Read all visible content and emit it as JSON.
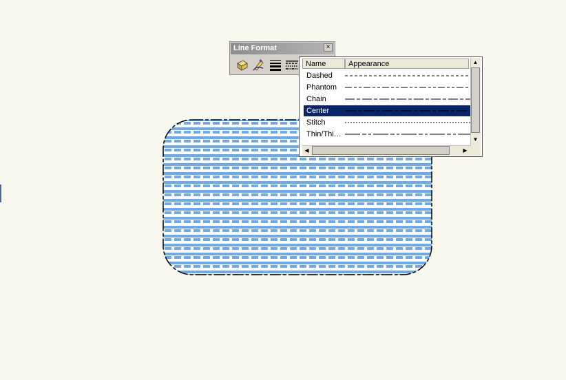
{
  "toolbar": {
    "title": "Line Format",
    "close_glyph": "×",
    "buttons": [
      {
        "icon": "fill-bucket-icon"
      },
      {
        "icon": "pen-color-icon"
      },
      {
        "icon": "line-weight-icon"
      },
      {
        "icon": "line-style-icon"
      }
    ]
  },
  "line_style_list": {
    "headers": [
      "Name",
      "Appearance"
    ],
    "selected": "Center",
    "items": [
      {
        "name": "Dashed",
        "dash": "4,3"
      },
      {
        "name": "Phantom",
        "dash": "10,3,4,3,4,3"
      },
      {
        "name": "Chain",
        "dash": "14,3,5,3"
      },
      {
        "name": "Center",
        "dash": "16,3,5,3"
      },
      {
        "name": "Stitch",
        "dash": "2,2"
      },
      {
        "name": "Thin/Thi…",
        "dash": "22,3,6,3,4,3"
      }
    ]
  },
  "colors": {
    "pattern_fill": "#6fa9e6",
    "shape_background": "#ffffff",
    "selection": "#0a246a",
    "titlebar": "#9a9a9a"
  }
}
